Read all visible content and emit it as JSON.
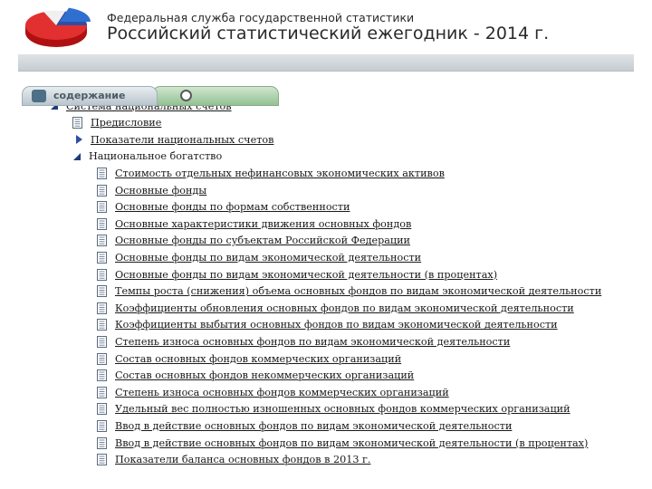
{
  "header": {
    "org_name": "Федеральная служба государственной статистики",
    "book_title": "Российский статистический ежегодник - 2014 г."
  },
  "tabs": [
    {
      "label": "содержание"
    }
  ],
  "tree": {
    "root": {
      "label": "Система национальных счетов",
      "state": "expanded"
    },
    "children": [
      {
        "label": "Предисловие",
        "type": "page"
      },
      {
        "label": "Показатели национальных счетов",
        "type": "folder",
        "state": "collapsed"
      },
      {
        "label": "Национальное богатство",
        "type": "folder",
        "state": "expanded",
        "children": [
          "Стоимость отдельных нефинансовых экономических активов",
          "Основные фонды",
          "Основные фонды по формам собственности",
          "Основные характеристики движения основных фондов",
          "Основные фонды по субъектам Российской Федерации",
          "Основные фонды по видам экономической деятельности",
          "Основные фонды по видам экономической деятельности (в процентах)",
          "Темпы роста (снижения) объема основных фондов по видам экономической деятельности",
          "Коэффициенты обновления основных фондов по видам экономической деятельности",
          "Коэффициенты выбытия основных фондов по видам экономической деятельности",
          "Степень износа основных фондов по видам экономической деятельности",
          "Состав основных фондов коммерческих организаций",
          "Состав основных фондов некоммерческих организаций",
          "Степень износа основных фондов коммерческих организаций",
          "Удельный вес полностью изношенных основных фондов коммерческих организаций",
          "Ввод в действие основных фондов по видам экономической деятельности",
          "Ввод в действие основных фондов по видам экономической деятельности (в процентах)",
          "Показатели баланса основных фондов в 2013 г."
        ]
      }
    ]
  },
  "colors": {
    "band": "#c6ccd1",
    "tab_contents": "#b9c5cc",
    "tab_index": "#93c193",
    "icon_blue": "#2f4ea3"
  }
}
